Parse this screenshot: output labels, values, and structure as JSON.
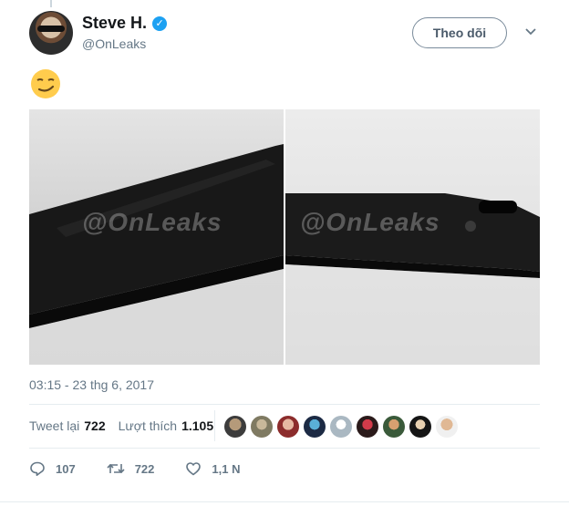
{
  "user": {
    "display_name": "Steve H.",
    "handle": "@OnLeaks",
    "verified": true
  },
  "follow_button_label": "Theo dõi",
  "tweet": {
    "emoji": "smirking-face",
    "photos": [
      {
        "watermark": "@OnLeaks"
      },
      {
        "watermark": "@OnLeaks"
      }
    ],
    "timestamp": "03:15 - 23 thg 6, 2017"
  },
  "stats": {
    "retweets_label": "Tweet lại",
    "retweets_count": "722",
    "likes_label": "Lượt thích",
    "likes_count": "1.105",
    "liker_avatars": 9
  },
  "actions": {
    "replies": "107",
    "retweets": "722",
    "likes": "1,1 N"
  },
  "colors": {
    "accent": "#1da1f2",
    "muted_text": "#657786",
    "divider": "#e6ecf0"
  }
}
